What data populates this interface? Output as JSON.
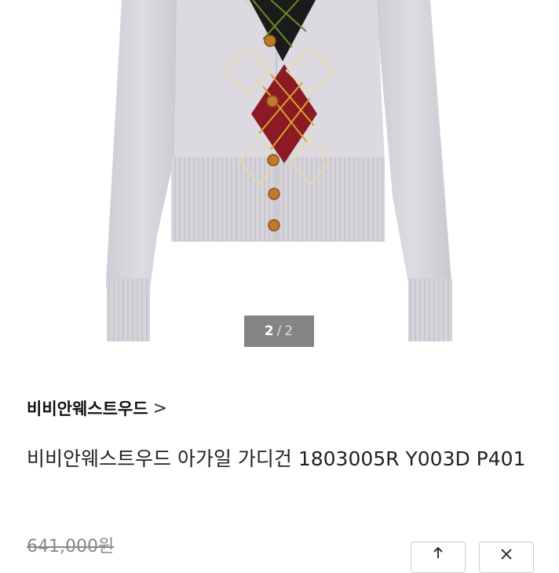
{
  "gallery": {
    "image_alt": "Vivienne Westwood argyle cardigan",
    "current_page": "2",
    "separator": "/",
    "total_pages": "2"
  },
  "brand": {
    "name": "비비안웨스트우드",
    "chevron": ">"
  },
  "product": {
    "title": "비비안웨스트우드 아가일 가디건 1803005R Y003D P401",
    "original_price": "641,000원"
  },
  "actions": {
    "share_icon": "share-icon",
    "close_icon": "close-icon"
  },
  "colors": {
    "garment": "#d9d6de",
    "diamond_dark": "#1b1b1b",
    "diamond_red": "#8b1a24",
    "button": "#c07a2c"
  }
}
